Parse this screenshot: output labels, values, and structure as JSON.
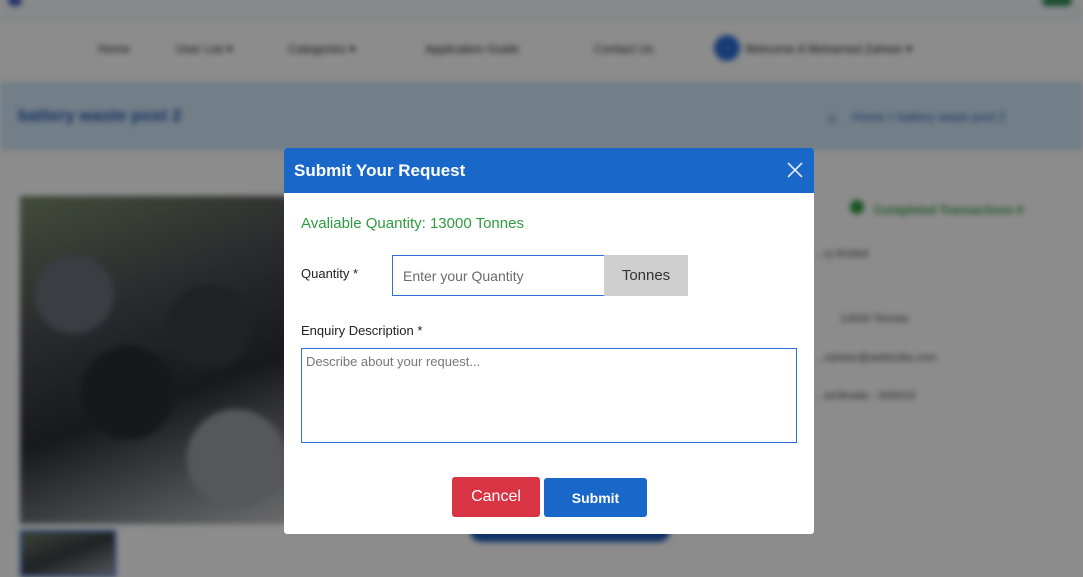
{
  "background": {
    "nav": {
      "items": [
        "Home",
        "User List ▾",
        "Categories ▾",
        "Application Guide",
        "Contact Us"
      ],
      "user_menu": "Welcome A Mohamed Zaheer ▾"
    },
    "page_title": "battery waste post 2",
    "breadcrumb": "Home > battery waste post 2",
    "side_info": {
      "badge": "Completed Transactions 0",
      "company": "...ry limited",
      "quantity": "13000 Tonnes",
      "email": "...zaheer@webindia.com",
      "location": "...amilnadu - 600023"
    }
  },
  "modal": {
    "title": "Submit Your Request",
    "available_quantity": "Avaliable Quantity: 13000 Tonnes",
    "quantity_label": "Quantity *",
    "quantity_placeholder": "Enter your Quantity",
    "quantity_unit": "Tonnes",
    "description_label": "Enquiry Description *",
    "description_placeholder": "Describe about your request...",
    "cancel_label": "Cancel",
    "submit_label": "Submit"
  },
  "colors": {
    "header_blue": "#1967c9",
    "available_green": "#2e9b3f",
    "cancel_red": "#d93444",
    "unit_gray": "#cfcfcf"
  },
  "icons": {
    "close": "close-icon",
    "home": "home-icon",
    "badge": "location-pin-icon"
  }
}
